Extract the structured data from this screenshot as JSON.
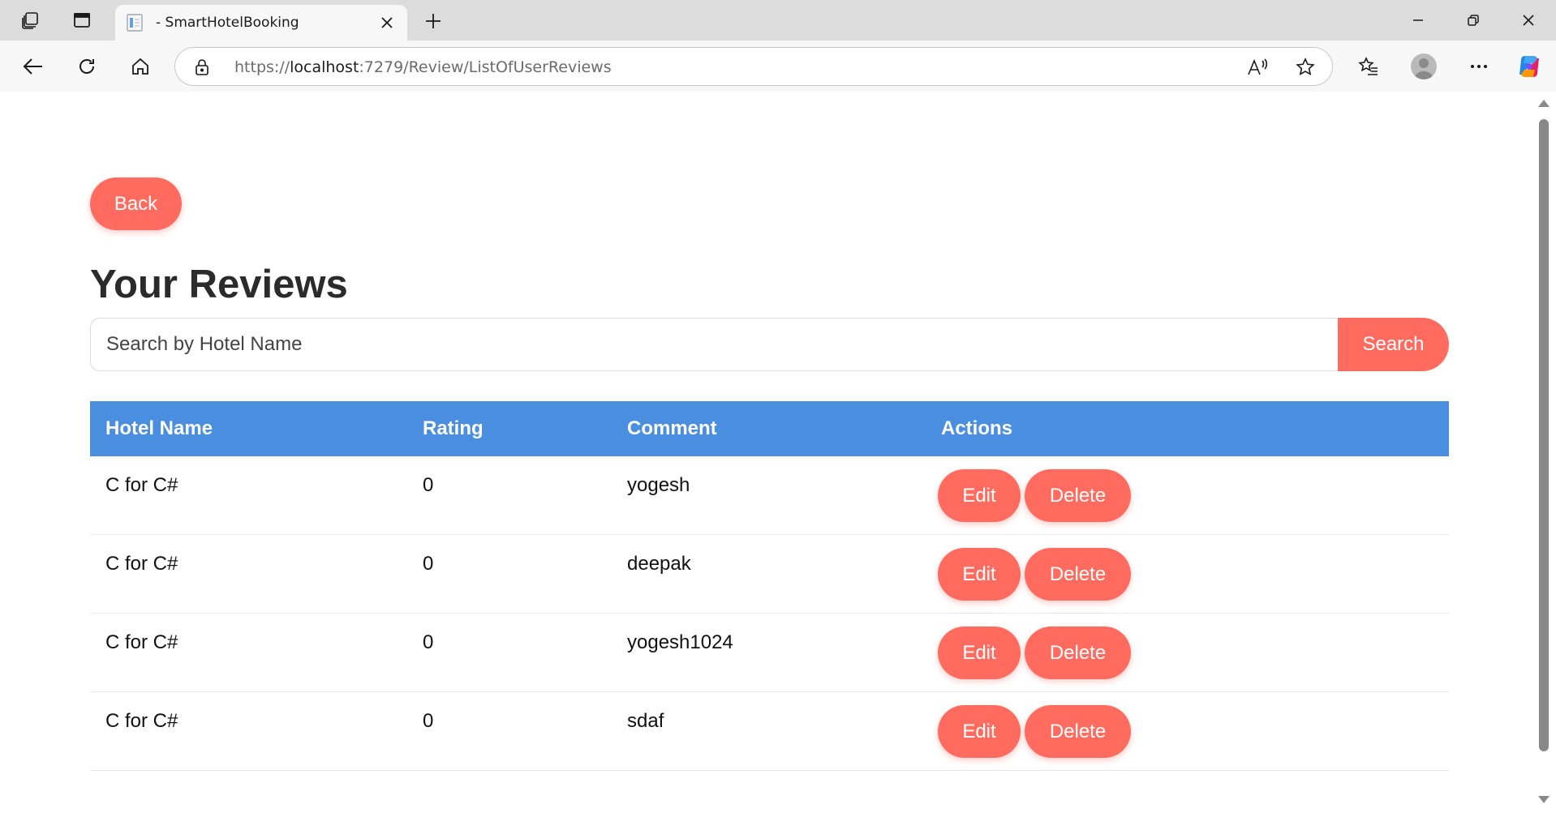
{
  "browser": {
    "tab_title": "- SmartHotelBooking",
    "url_prefix": "https://",
    "url_host": "localhost",
    "url_path": ":7279/Review/ListOfUserReviews",
    "icons": [
      "workspaces-icon",
      "vertical-tabs-icon",
      "page-favicon",
      "close-tab-icon",
      "new-tab-icon",
      "minimize-icon",
      "restore-icon",
      "close-window-icon",
      "back-arrow-icon",
      "refresh-icon",
      "home-icon",
      "lock-icon",
      "read-aloud-icon",
      "star-icon",
      "favorites-icon",
      "profile-avatar",
      "more-icon",
      "copilot-icon"
    ]
  },
  "page": {
    "back_label": "Back",
    "title": "Your Reviews",
    "search": {
      "placeholder": "Search by Hotel Name",
      "button_label": "Search"
    },
    "table": {
      "headers": {
        "hotel": "Hotel Name",
        "rating": "Rating",
        "comment": "Comment",
        "actions": "Actions"
      },
      "edit_label": "Edit",
      "delete_label": "Delete",
      "rows": [
        {
          "hotel": "C for C#",
          "rating": "0",
          "comment": "yogesh"
        },
        {
          "hotel": "C for C#",
          "rating": "0",
          "comment": "deepak"
        },
        {
          "hotel": "C for C#",
          "rating": "0",
          "comment": "yogesh1024"
        },
        {
          "hotel": "C for C#",
          "rating": "0",
          "comment": "sdaf"
        }
      ]
    }
  },
  "colors": {
    "accent": "#ff6b5e",
    "table_header": "#4a8ee0",
    "title": "#2b2b2b"
  }
}
